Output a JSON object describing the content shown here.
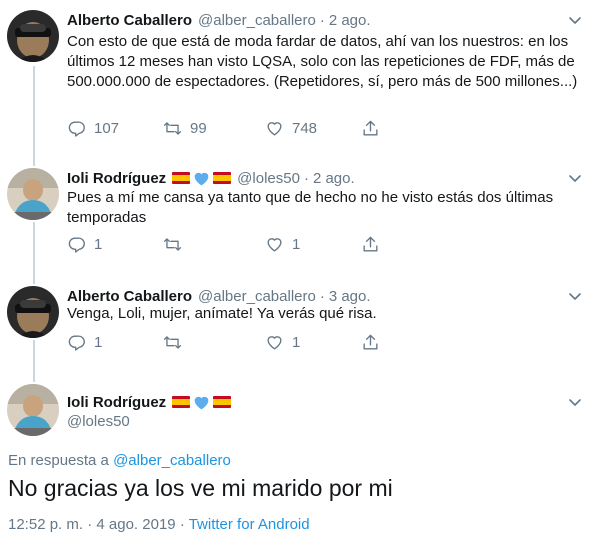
{
  "tweets": [
    {
      "name": "Alberto Caballero",
      "handle": "@alber_caballero",
      "separator": "·",
      "date": "2 ago.",
      "text": "Con esto de que está de moda fardar de datos, ahí van los nuestros: en los últimos 12 meses han visto LQSA, solo con las repeticiones de FDF, más de 500.000.000 de espectadores. (Repetidores, sí, pero más de 500 millones...)",
      "replies": "107",
      "retweets": "99",
      "likes": "748"
    },
    {
      "name": "Ioli Rodríguez",
      "handle": "@loles50",
      "separator": "·",
      "date": "2 ago.",
      "text": "Pues a mí me cansa ya tanto que de hecho no he visto estás dos últimas temporadas",
      "replies": "1",
      "retweets": "",
      "likes": "1"
    },
    {
      "name": "Alberto Caballero",
      "handle": "@alber_caballero",
      "separator": "·",
      "date": "3 ago.",
      "text": "Venga, Loli, mujer, anímate! Ya verás qué risa.",
      "replies": "1",
      "retweets": "",
      "likes": "1"
    }
  ],
  "main_tweet": {
    "name": "Ioli Rodríguez",
    "handle": "@loles50",
    "reply_prefix": "En respuesta a",
    "reply_to": "@alber_caballero",
    "text": "No gracias ya los ve mi marido por mi",
    "time": "12:52 p. m.",
    "meta_separator": "·",
    "date": "4 ago. 2019",
    "source": "Twitter for Android"
  },
  "icons": {
    "reply": "reply-icon",
    "retweet": "retweet-icon",
    "like": "heart-icon",
    "share": "share-icon",
    "menu": "chevron-down-icon",
    "flag": "spain-flag-icon",
    "blue_heart": "blue-heart-icon"
  },
  "colors": {
    "text": "#14171a",
    "secondary": "#657786",
    "link": "#1b95e0",
    "thread_line": "#ccd6dd",
    "flag_red": "#c60b1e",
    "flag_yellow": "#ffc400",
    "blue_heart": "#5dadec"
  }
}
